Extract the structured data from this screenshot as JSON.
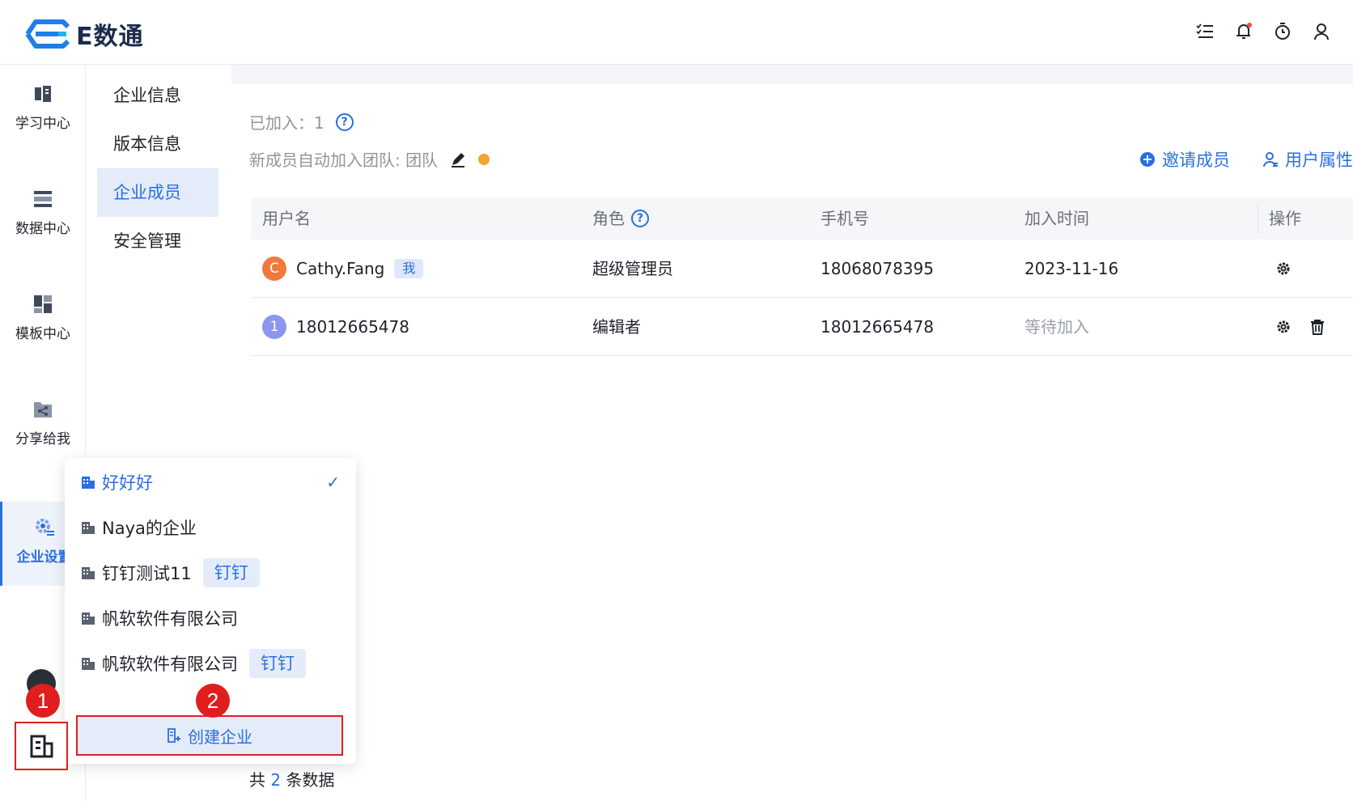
{
  "header": {
    "logo_text": "E数通",
    "icons": [
      "task-list-icon",
      "bell-icon",
      "timer-icon",
      "user-icon"
    ]
  },
  "left_nav": {
    "items": [
      {
        "label": "学习中心",
        "icon": "book-icon"
      },
      {
        "label": "数据中心",
        "icon": "database-icon"
      },
      {
        "label": "模板中心",
        "icon": "template-icon"
      },
      {
        "label": "分享给我",
        "icon": "share-folder-icon"
      },
      {
        "label": "企业设置",
        "icon": "gear-list-icon",
        "active": true
      }
    ]
  },
  "sub_nav": {
    "items": [
      {
        "label": "企业信息"
      },
      {
        "label": "版本信息"
      },
      {
        "label": "企业成员",
        "active": true
      },
      {
        "label": "安全管理"
      }
    ]
  },
  "main": {
    "joined_label": "已加入：",
    "joined_count": "1",
    "auto_join_label": "新成员自动加入团队: 团队",
    "invite_label": "邀请成员",
    "user_attr_label": "用户属性",
    "table": {
      "headers": [
        "用户名",
        "角色",
        "手机号",
        "加入时间",
        "操作"
      ],
      "rows": [
        {
          "avatar": "C",
          "avatar_color": "#f07a3c",
          "name": "Cathy.Fang",
          "tag": "我",
          "role": "超级管理员",
          "phone": "18068078395",
          "joined": "2023-11-16"
        },
        {
          "avatar": "1",
          "avatar_color": "#8b96f0",
          "name": "18012665478",
          "tag": "",
          "role": "编辑者",
          "phone": "18012665478",
          "joined": "等待加入"
        }
      ]
    },
    "footer_prefix": "共",
    "footer_count": "2",
    "footer_suffix": "条数据"
  },
  "dropdown": {
    "items": [
      {
        "label": "好好好",
        "tag": "",
        "selected": true
      },
      {
        "label": "Naya的企业",
        "tag": ""
      },
      {
        "label": "钉钉测试11",
        "tag": "钉钉"
      },
      {
        "label": "帆软软件有限公司",
        "tag": ""
      },
      {
        "label": "帆软软件有限公司",
        "tag": "钉钉"
      }
    ],
    "check_mark": "✓",
    "create_label": "创建企业"
  },
  "markers": {
    "one": "1",
    "two": "2"
  },
  "colors": {
    "accent": "#2a6fe0",
    "highlight_border": "#e01e1e",
    "avatar_orange": "#f07a3c",
    "avatar_purple": "#8b96f0",
    "status_dot": "#f3a52e"
  }
}
